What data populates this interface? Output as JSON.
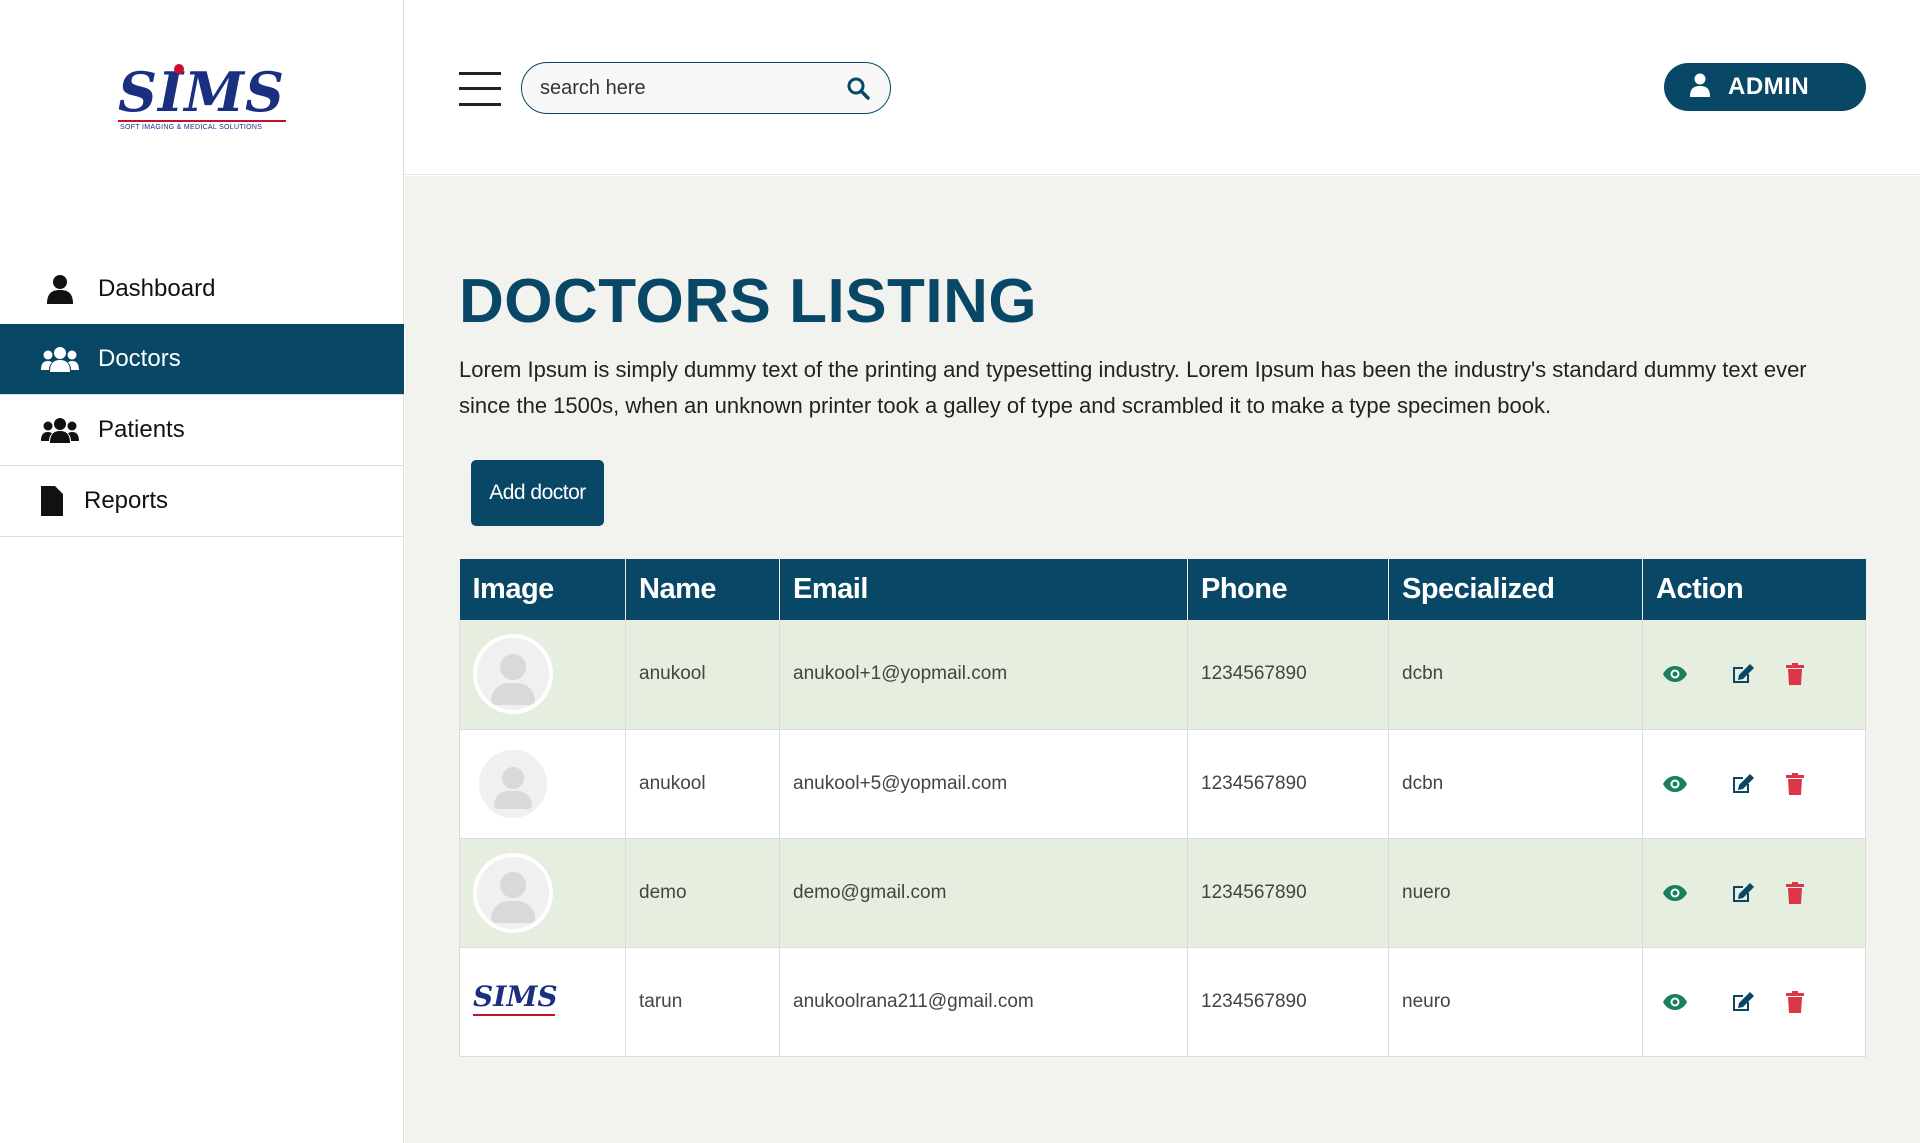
{
  "brand": {
    "logo_text": "SIMS",
    "tagline": "SOFT IMAGING & MEDICAL SOLUTIONS",
    "primary_color": "#084765",
    "accent_color": "#c8102e"
  },
  "sidebar": {
    "items": [
      {
        "label": "Dashboard",
        "icon": "user-icon",
        "active": false
      },
      {
        "label": "Doctors",
        "icon": "users-icon",
        "active": true
      },
      {
        "label": "Patients",
        "icon": "users-icon",
        "active": false
      },
      {
        "label": "Reports",
        "icon": "file-icon",
        "active": false
      }
    ]
  },
  "header": {
    "search_placeholder": "search here",
    "admin_label": "ADMIN"
  },
  "main": {
    "title": "DOCTORS LISTING",
    "description": "Lorem Ipsum is simply dummy text of the printing and typesetting industry. Lorem Ipsum has been the industry's standard dummy text ever since the 1500s, when an unknown printer took a galley of type and scrambled it to make a type specimen book.",
    "add_button": "Add doctor"
  },
  "table": {
    "headers": [
      "Image",
      "Name",
      "Email",
      "Phone",
      "Specialized",
      "Action"
    ],
    "rows": [
      {
        "image": "avatar-placeholder",
        "name": "anukool",
        "email": "anukool+1@yopmail.com",
        "phone": "1234567890",
        "specialized": "dcbn"
      },
      {
        "image": "avatar-placeholder",
        "name": "anukool",
        "email": "anukool+5@yopmail.com",
        "phone": "1234567890",
        "specialized": "dcbn"
      },
      {
        "image": "avatar-placeholder",
        "name": "demo",
        "email": "demo@gmail.com",
        "phone": "1234567890",
        "specialized": "nuero"
      },
      {
        "image": "sims-logo",
        "name": "tarun",
        "email": "anukoolrana211@gmail.com",
        "phone": "1234567890",
        "specialized": "neuro"
      }
    ],
    "action_icons": [
      "eye-icon",
      "edit-icon",
      "trash-icon"
    ],
    "action_colors": {
      "view": "#1a7f5a",
      "edit": "#084765",
      "delete": "#dc3545"
    }
  }
}
